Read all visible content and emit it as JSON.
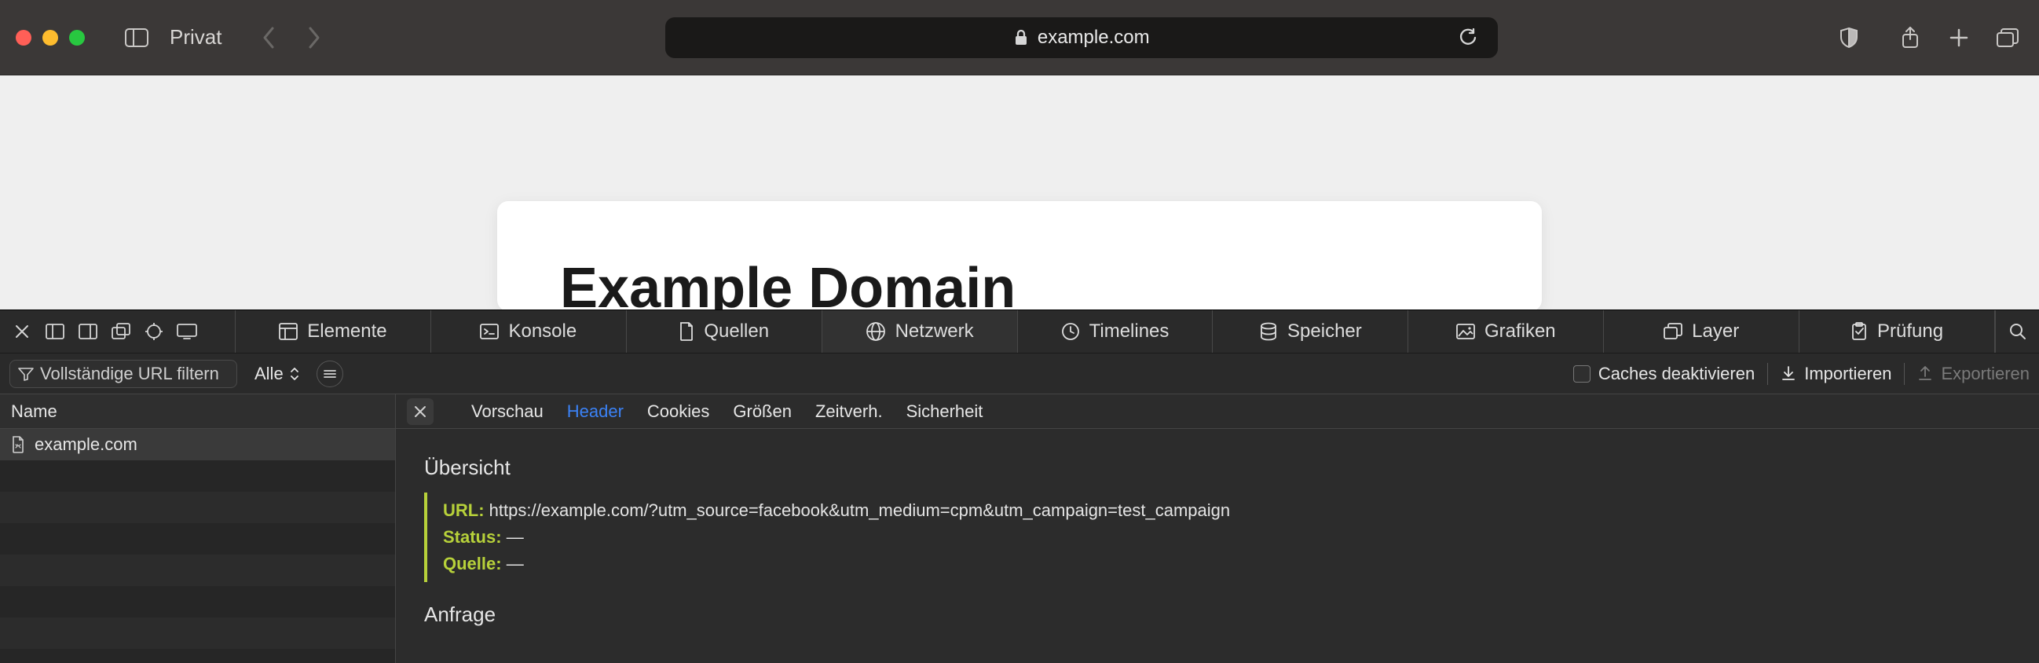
{
  "chrome": {
    "private_label": "Privat",
    "address_display": "example.com"
  },
  "page": {
    "heading": "Example Domain"
  },
  "devtools": {
    "tabs": {
      "elements": "Elemente",
      "console": "Konsole",
      "sources": "Quellen",
      "network": "Netzwerk",
      "timelines": "Timelines",
      "storage": "Speicher",
      "graphics": "Grafiken",
      "layers": "Layer",
      "audit": "Prüfung"
    }
  },
  "network": {
    "filter_placeholder": "Vollständige URL filtern",
    "all_label": "Alle",
    "disable_caches": "Caches deaktivieren",
    "import_label": "Importieren",
    "export_label": "Exportieren",
    "list_header": "Name",
    "rows": [
      {
        "name": "example.com"
      }
    ],
    "detail_tabs": {
      "preview": "Vorschau",
      "header": "Header",
      "cookies": "Cookies",
      "sizes": "Größen",
      "timing": "Zeitverh.",
      "security": "Sicherheit"
    },
    "overview": {
      "title": "Übersicht",
      "url_label": "URL:",
      "url_value": "https://example.com/?utm_source=facebook&utm_medium=cpm&utm_campaign=test_campaign",
      "status_label": "Status:",
      "status_value": "—",
      "source_label": "Quelle:",
      "source_value": "—"
    },
    "request": {
      "title": "Anfrage"
    }
  }
}
